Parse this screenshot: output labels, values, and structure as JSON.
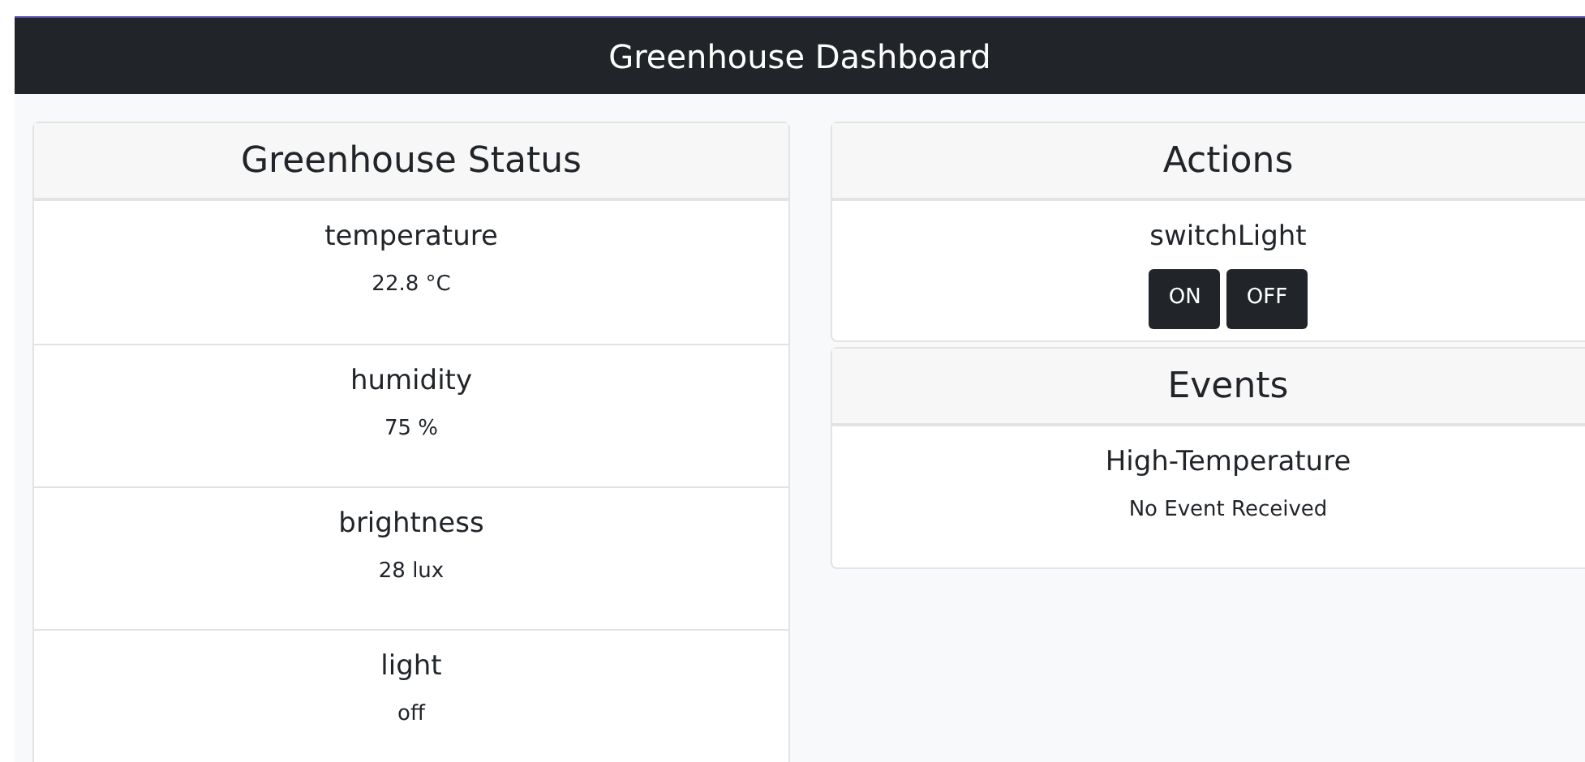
{
  "navbar": {
    "title": "Greenhouse Dashboard"
  },
  "status": {
    "title": "Greenhouse Status",
    "properties": [
      {
        "name": "temperature",
        "value": "22.8 °C"
      },
      {
        "name": "humidity",
        "value": "75 %"
      },
      {
        "name": "brightness",
        "value": "28 lux"
      },
      {
        "name": "light",
        "value": "off"
      }
    ]
  },
  "actions": {
    "title": "Actions",
    "items": [
      {
        "name": "switchLight",
        "buttons": [
          "ON",
          "OFF"
        ]
      }
    ]
  },
  "events": {
    "title": "Events",
    "items": [
      {
        "name": "High-Temperature",
        "message": "No Event Received"
      }
    ]
  }
}
